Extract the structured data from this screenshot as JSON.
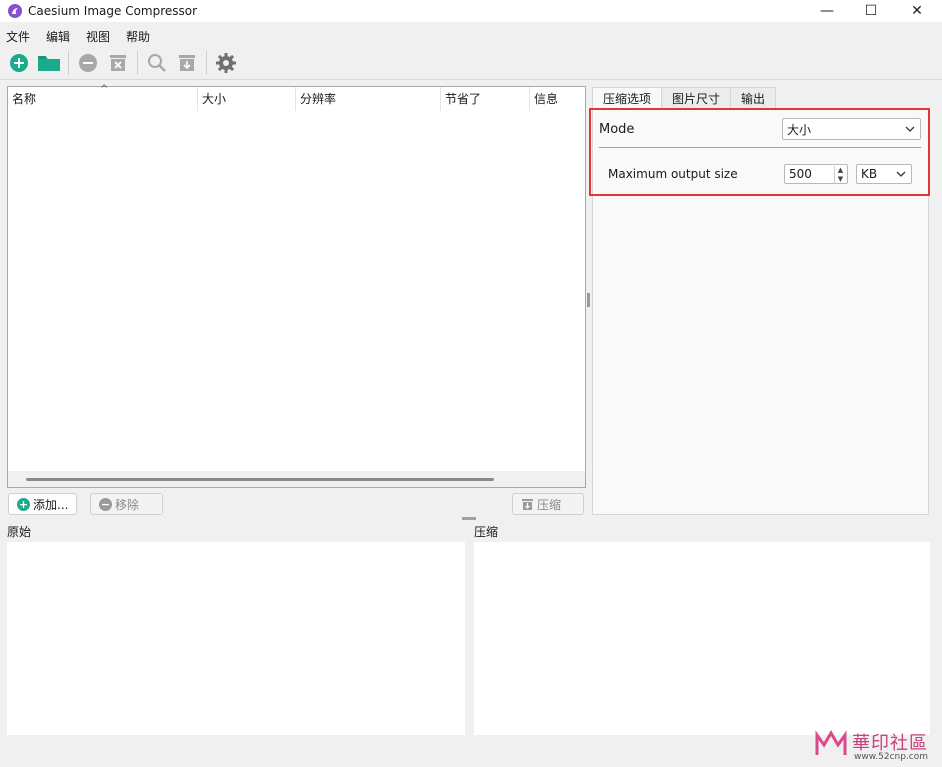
{
  "window": {
    "title": "Caesium Image Compressor",
    "controls": {
      "minimize": "—",
      "maximize": "☐",
      "close": "✕"
    }
  },
  "menu": [
    "文件",
    "编辑",
    "视图",
    "帮助"
  ],
  "toolbar": {
    "icons": [
      "add-icon",
      "open-folder-icon",
      "remove-icon",
      "clear-list-icon",
      "preview-search-icon",
      "compress-icon",
      "settings-icon"
    ],
    "accent": "#1aaa8c"
  },
  "file_list": {
    "columns": [
      "名称",
      "大小",
      "分辨率",
      "节省了",
      "信息"
    ],
    "sort_indicator": "^",
    "rows": []
  },
  "buttons": {
    "add": "添加...",
    "remove": "移除",
    "compress": "压缩"
  },
  "tabs": [
    "压缩选项",
    "图片尺寸",
    "输出"
  ],
  "compression": {
    "mode_label": "Mode",
    "mode_value": "大小",
    "max_output_label": "Maximum output size",
    "max_output_value": "500",
    "unit_value": "KB"
  },
  "preview": {
    "original_label": "原始",
    "compressed_label": "压缩"
  },
  "watermark": {
    "text": "華印社區",
    "url": "www.52cnp.com"
  },
  "colors": {
    "highlight": "#e0363a",
    "add_green": "#1aaa8c",
    "disabled_gray": "#9a9a9a"
  }
}
